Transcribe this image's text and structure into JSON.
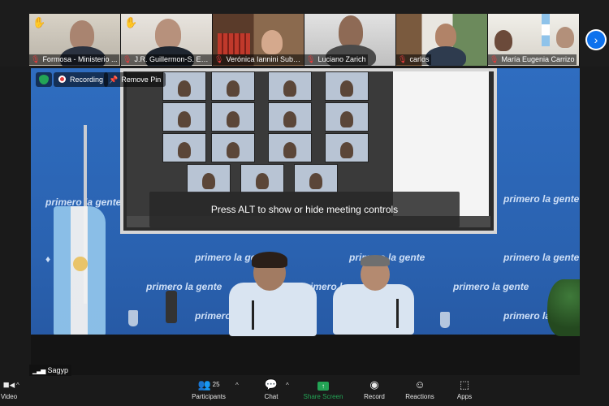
{
  "gallery": {
    "participants": [
      {
        "name": "Formosa - Ministerio ...",
        "raised_hand": true,
        "mic_muted": true
      },
      {
        "name": "J.R. Guillermon-S. Estero",
        "raised_hand": true,
        "mic_muted": true
      },
      {
        "name": "Verónica Iannini Subs...",
        "raised_hand": false,
        "mic_muted": true
      },
      {
        "name": "Luciano Zarich",
        "raised_hand": false,
        "mic_muted": true
      },
      {
        "name": "carlos",
        "raised_hand": false,
        "mic_muted": true
      },
      {
        "name": "María Eugenia Carrizo",
        "raised_hand": false,
        "mic_muted": true
      }
    ],
    "next_page_icon": "chevron-right-icon"
  },
  "main": {
    "security_icon": "shield-check-icon",
    "recording_label": "Recording",
    "remove_pin_label": "Remove Pin",
    "hint_text": "Press ALT to show or hide meeting controls",
    "speaker_name": "Sagyp",
    "backdrop_logo": "primero la gente"
  },
  "toolbar": {
    "video_label": "Video",
    "participants_label": "Participants",
    "participants_count": "25",
    "chat_label": "Chat",
    "share_label": "Share Screen",
    "record_label": "Record",
    "reactions_label": "Reactions",
    "apps_label": "Apps"
  },
  "colors": {
    "accent": "#0e72ed",
    "share_green": "#23a455",
    "muted_red": "#e03c3c",
    "backdrop_blue": "#2d66b8",
    "toolbar_bg": "#1a1a1a"
  }
}
